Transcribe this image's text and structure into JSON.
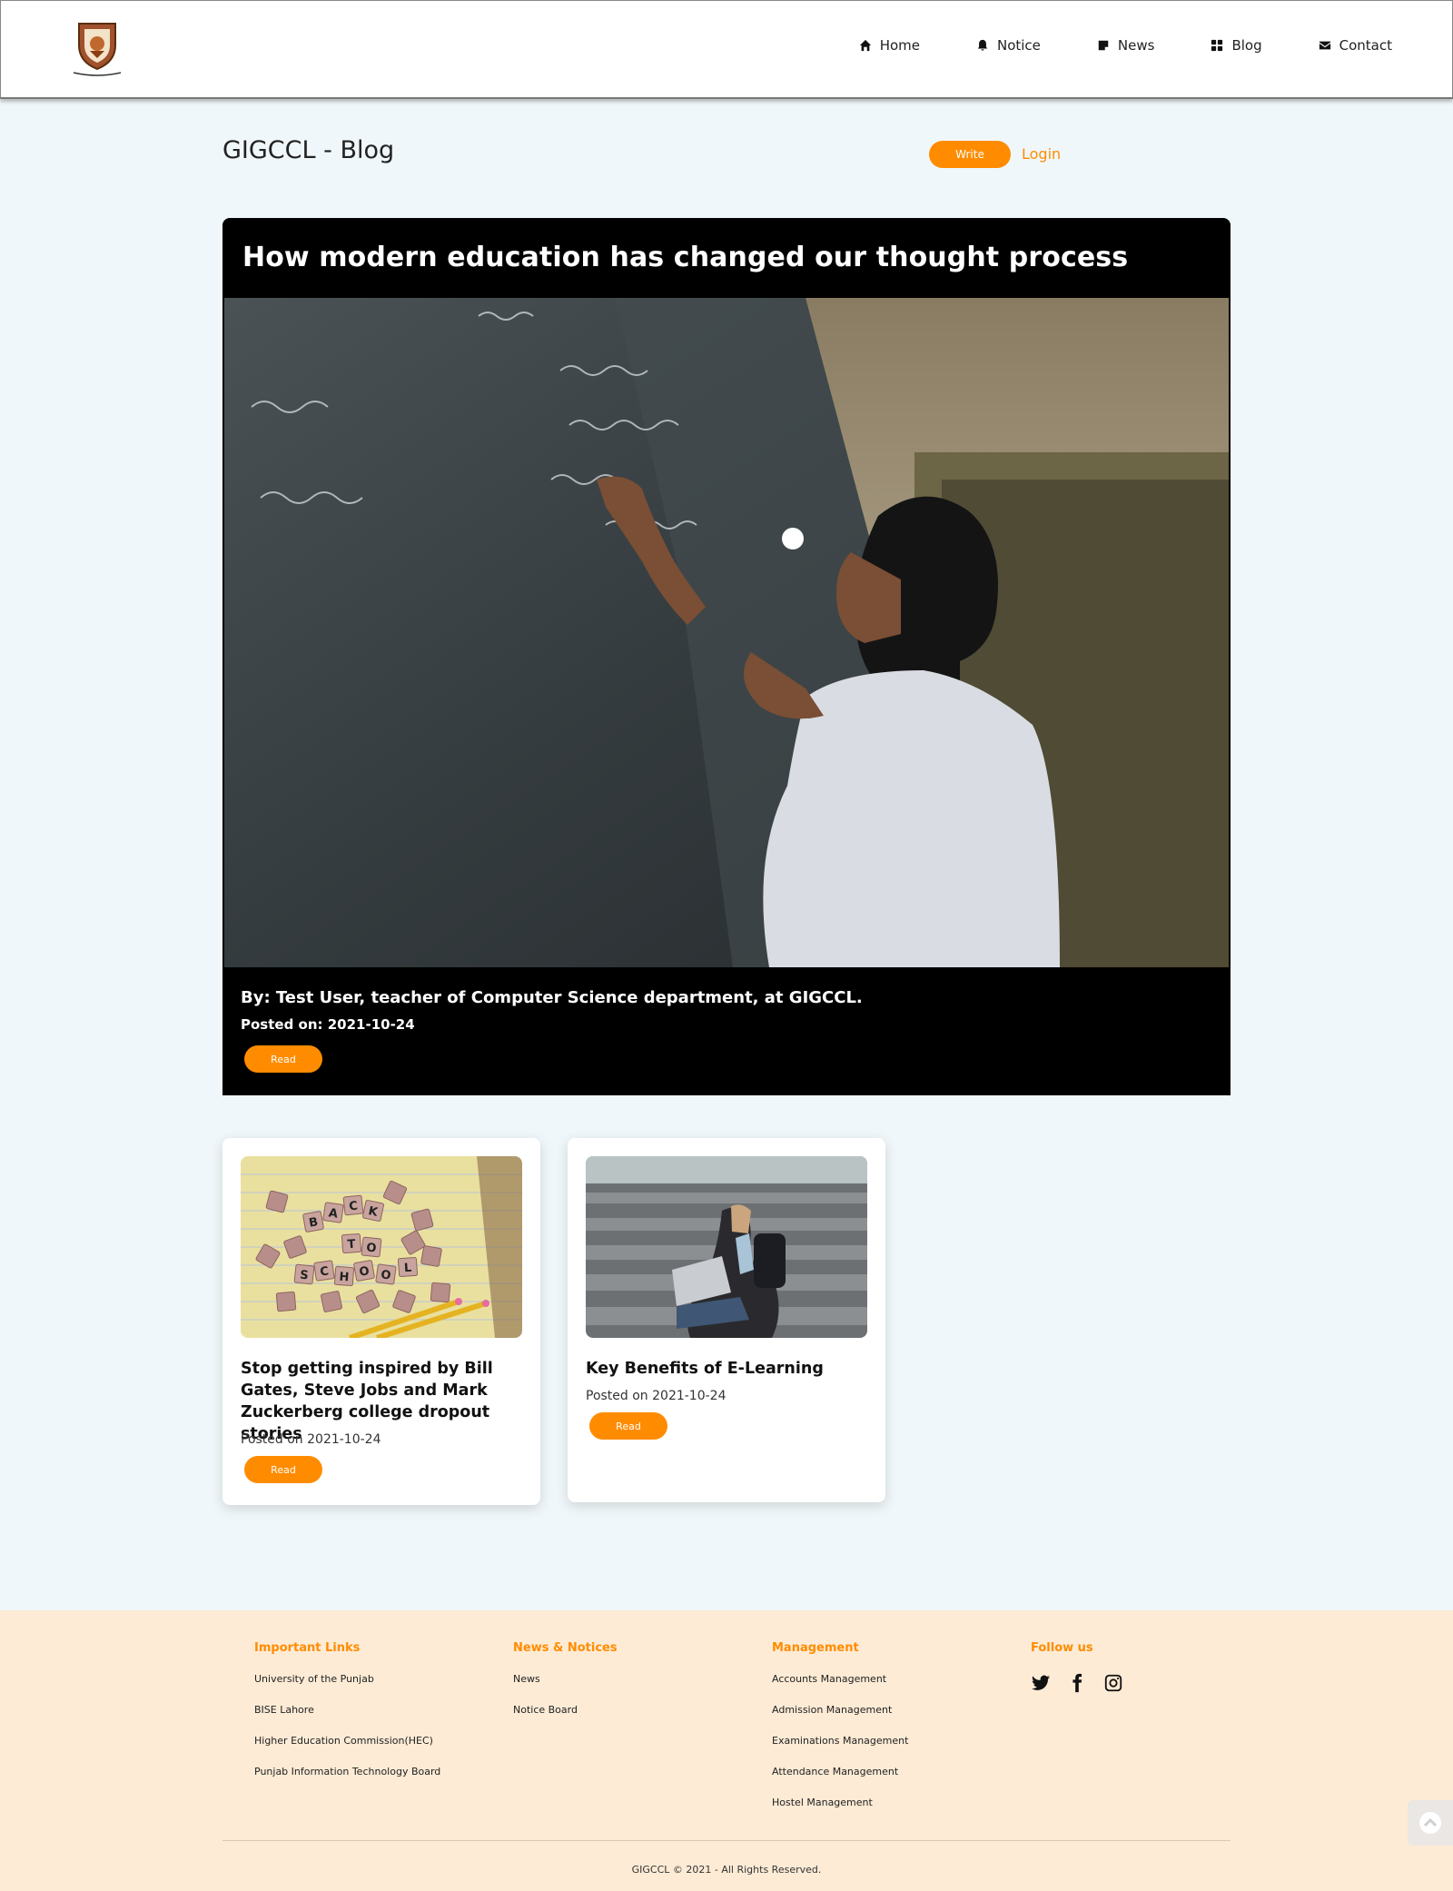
{
  "nav": {
    "items": [
      {
        "label": "Home",
        "icon": "home-icon"
      },
      {
        "label": "Notice",
        "icon": "bell-icon"
      },
      {
        "label": "News",
        "icon": "sticky-note-icon"
      },
      {
        "label": "Blog",
        "icon": "grid-icon"
      },
      {
        "label": "Contact",
        "icon": "envelope-icon"
      }
    ]
  },
  "header": {
    "title": "GIGCCL - Blog",
    "write_label": "Write",
    "login_label": "Login"
  },
  "featured": {
    "title": "How modern education has changed our thought process",
    "author": "By: Test User, teacher of Computer Science department, at GIGCCL.",
    "posted": "Posted on: 2021-10-24",
    "read_label": "Read"
  },
  "cards": [
    {
      "title": "Stop getting inspired by Bill Gates, Steve Jobs and Mark Zuckerberg college dropout stories",
      "posted": "Posted on 2021-10-24",
      "read_label": "Read",
      "image_letters": [
        "B",
        "A",
        "C",
        "K",
        "T",
        "O",
        "S",
        "C",
        "H",
        "O",
        "O",
        "L"
      ]
    },
    {
      "title": "Key Benefits of E-Learning",
      "posted": "Posted on 2021-10-24",
      "read_label": "Read"
    }
  ],
  "footer": {
    "important_links": {
      "heading": "Important Links",
      "items": [
        "University of the Punjab",
        "BISE Lahore",
        "Higher Education Commission(HEC)",
        "Punjab Information Technology Board"
      ]
    },
    "news_notices": {
      "heading": "News & Notices",
      "items": [
        "News",
        "Notice Board"
      ]
    },
    "management": {
      "heading": "Management",
      "items": [
        "Accounts Management",
        "Admission Management",
        "Examinations Management",
        "Attendance Management",
        "Hostel Management"
      ]
    },
    "follow": {
      "heading": "Follow us",
      "icons": [
        "twitter-icon",
        "facebook-icon",
        "instagram-icon"
      ]
    },
    "copyright": "GIGCCL © 2021 - All Rights Reserved."
  },
  "colors": {
    "accent": "#ff8c00",
    "page_bg": "#f0f7fa",
    "footer_bg": "#fdebd5",
    "featured_bg": "#000000"
  }
}
